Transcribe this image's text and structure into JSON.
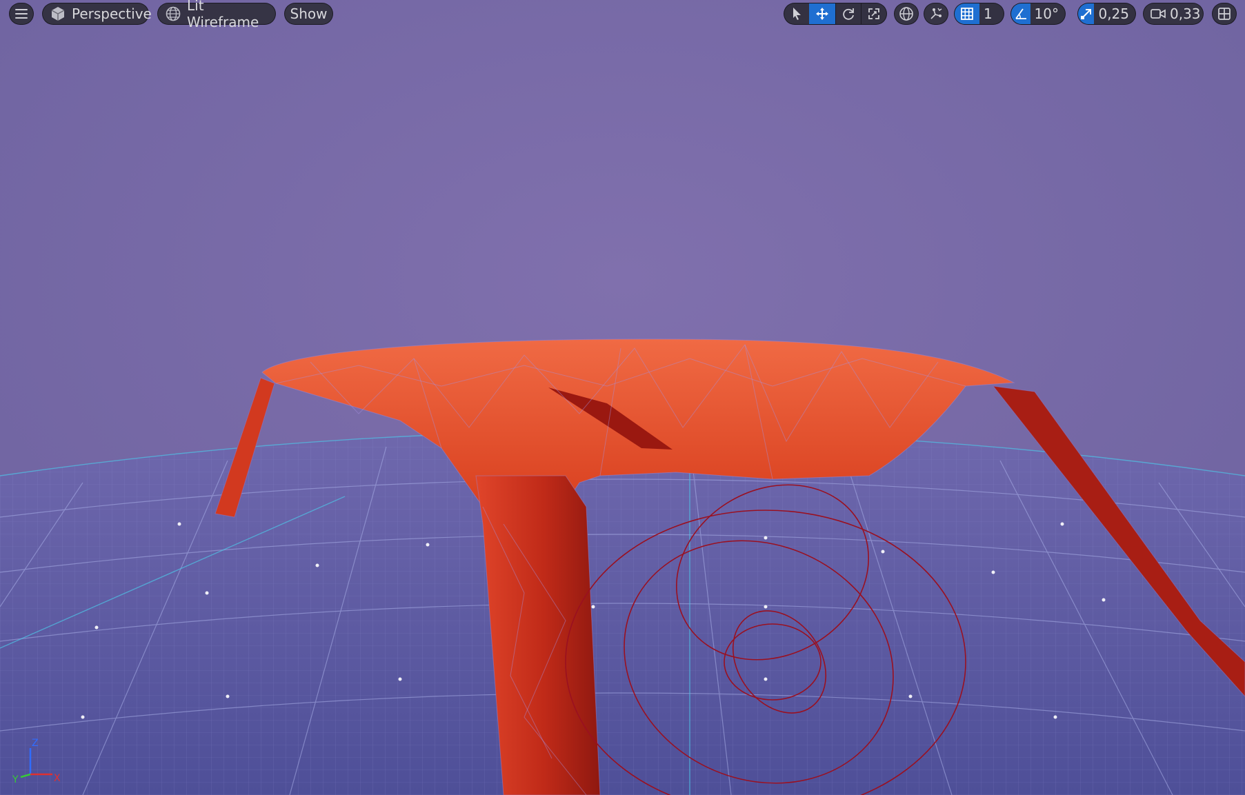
{
  "viewport": {
    "menu_icon": "hamburger-icon",
    "view_mode": {
      "label": "Perspective",
      "icon": "cube-icon"
    },
    "render_mode": {
      "label": "Lit Wireframe",
      "icon": "globe-wire-icon"
    },
    "show": {
      "label": "Show"
    },
    "tools": {
      "select_icon": "cursor-icon",
      "translate_icon": "move-icon",
      "rotate_icon": "rotate-icon",
      "scale_icon": "scale-icon",
      "coord_space_icon": "world-icon",
      "surface_snap_icon": "surface-snap-icon",
      "grid_snap": {
        "icon": "grid-icon",
        "value": "1"
      },
      "rotation_snap": {
        "icon": "angle-icon",
        "value": "10°"
      },
      "scale_snap": {
        "icon": "scale-arrow-icon",
        "value": "0,25"
      },
      "camera_speed": {
        "icon": "camera-icon",
        "value": "0,33"
      },
      "layout_icon": "layout-grid-icon"
    },
    "axis_labels": {
      "z": "Z",
      "y": "Y",
      "x": "X"
    },
    "colors": {
      "background": "#7a6ea7",
      "floor": "#5a58a0",
      "mesh": "#e04a2a",
      "mesh_dark": "#a81e14",
      "accent": "#1f6fd1",
      "wire_gizmo": "#9a1020"
    }
  }
}
